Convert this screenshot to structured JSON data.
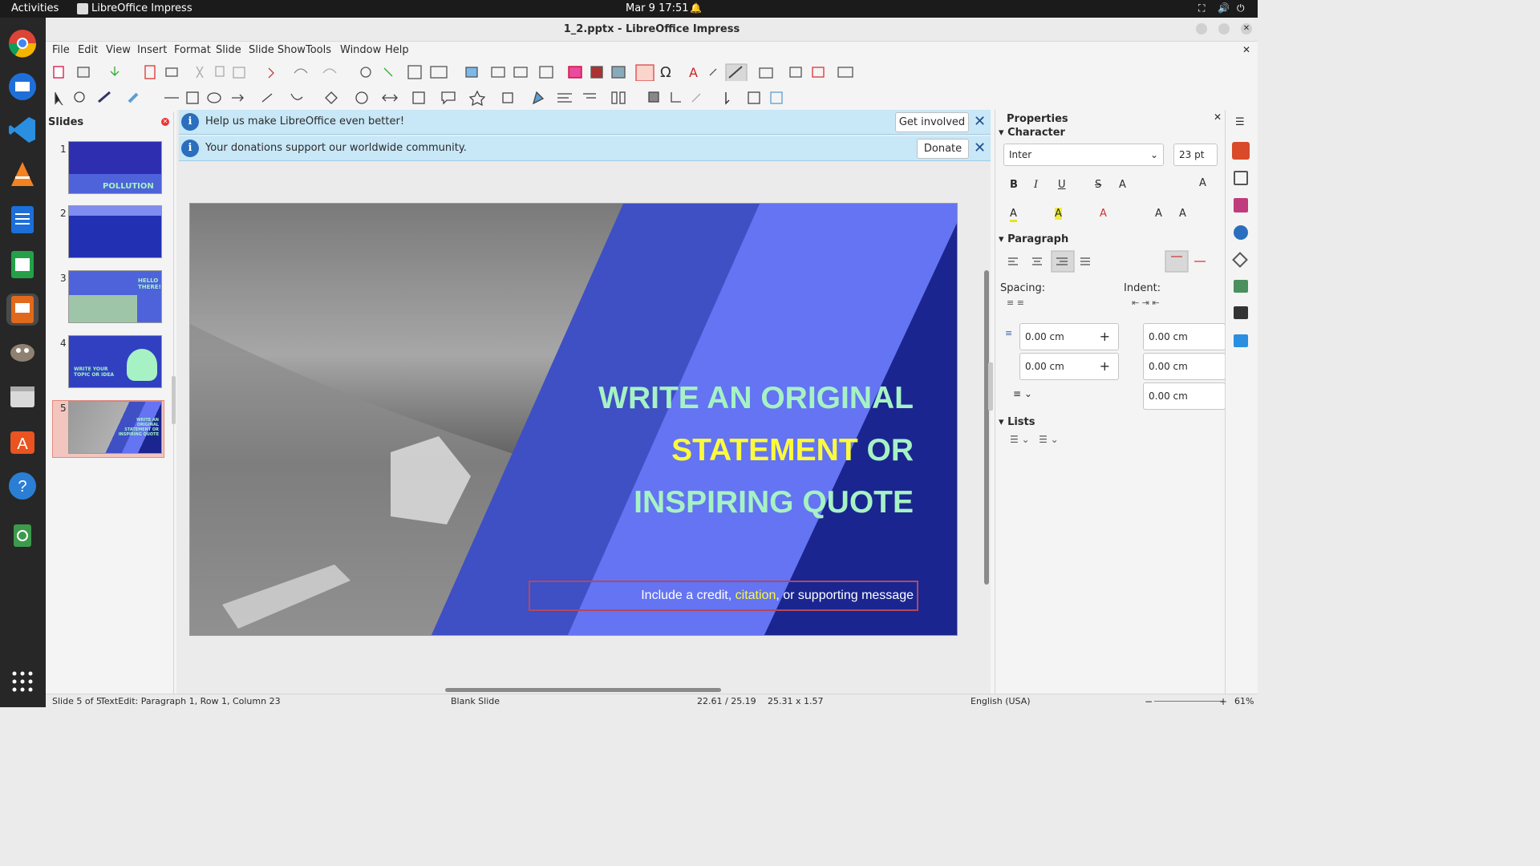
{
  "topbar": {
    "activities": "Activities",
    "app_name": "LibreOffice Impress",
    "datetime": "Mar 9  17:51"
  },
  "window": {
    "title": "1_2.pptx - LibreOffice Impress"
  },
  "menu": [
    "File",
    "Edit",
    "View",
    "Insert",
    "Format",
    "Slide",
    "Slide Show",
    "Tools",
    "Window",
    "Help"
  ],
  "slides_panel": {
    "title": "Slides",
    "slides": [
      {
        "num": "1",
        "label": "POLLUTION"
      },
      {
        "num": "2",
        "label": ""
      },
      {
        "num": "3",
        "label": "HELLO THERE!"
      },
      {
        "num": "4",
        "label": "WRITE YOUR TOPIC OR IDEA"
      },
      {
        "num": "5",
        "label": "WRITE AN ORIGINAL STATEMENT OR INSPIRING QUOTE"
      }
    ],
    "selected": 5
  },
  "infobars": [
    {
      "text": "Help us make LibreOffice even better!",
      "button": "Get involved"
    },
    {
      "text": "Your donations support our worldwide community.",
      "button": "Donate"
    }
  ],
  "slide": {
    "line1": "WRITE AN ORIGINAL",
    "line2_highlight": "STATEMENT",
    "line2_rest": " OR",
    "line3": "INSPIRING QUOTE",
    "sub_before": "Include a credit, ",
    "sub_highlight": "citation",
    "sub_after": ", or supporting message",
    "colors": {
      "mint": "#a6f2c4",
      "yellow": "#fbfb3c",
      "blue1": "#3f4fc4",
      "blue2": "#6474f2",
      "blue3": "#1a2590"
    }
  },
  "properties": {
    "title": "Properties",
    "character": "Character",
    "font": "Inter",
    "size": "23 pt",
    "paragraph": "Paragraph",
    "spacing": "Spacing:",
    "indent": "Indent:",
    "spacing_above": "0.00 cm",
    "spacing_below": "0.00 cm",
    "indent_before": "0.00 cm",
    "indent_after": "0.00 cm",
    "indent_first": "0.00 cm",
    "lists": "Lists"
  },
  "status": {
    "slide": "Slide 5 of 5",
    "edit": "TextEdit: Paragraph 1, Row 1, Column 23",
    "layout": "Blank Slide",
    "pos": "22.61 / 25.19",
    "size": "25.31 x 1.57",
    "lang": "English (USA)",
    "zoom": "61%"
  }
}
